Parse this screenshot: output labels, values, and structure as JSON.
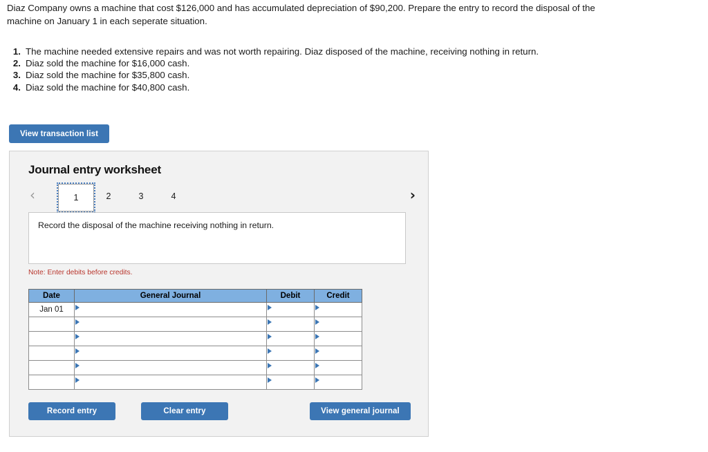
{
  "problem": {
    "statement": "Diaz Company owns a machine that cost $126,000 and has accumulated depreciation of $90,200. Prepare the entry to record the disposal of the machine on January 1 in each seperate situation.",
    "requirements": [
      {
        "num": "1.",
        "text": "The machine needed extensive repairs and was not worth repairing. Diaz disposed of the machine, receiving nothing in return."
      },
      {
        "num": "2.",
        "text": "Diaz sold the machine for $16,000 cash."
      },
      {
        "num": "3.",
        "text": "Diaz sold the machine for $35,800 cash."
      },
      {
        "num": "4.",
        "text": "Diaz sold the machine for $40,800 cash."
      }
    ]
  },
  "toolbar": {
    "view_transaction_list_label": "View transaction list"
  },
  "worksheet": {
    "title": "Journal entry worksheet",
    "tabs": [
      {
        "label": "1",
        "active": true
      },
      {
        "label": "2",
        "active": false
      },
      {
        "label": "3",
        "active": false
      },
      {
        "label": "4",
        "active": false
      }
    ],
    "prev_arrow": "‹",
    "next_arrow": "›",
    "instruction": "Record the disposal of the machine receiving nothing in return.",
    "note": "Note: Enter debits before credits.",
    "table": {
      "headers": [
        "Date",
        "General Journal",
        "Debit",
        "Credit"
      ],
      "rows": [
        {
          "date": "Jan 01",
          "general_journal": "",
          "debit": "",
          "credit": ""
        },
        {
          "date": "",
          "general_journal": "",
          "debit": "",
          "credit": ""
        },
        {
          "date": "",
          "general_journal": "",
          "debit": "",
          "credit": ""
        },
        {
          "date": "",
          "general_journal": "",
          "debit": "",
          "credit": ""
        },
        {
          "date": "",
          "general_journal": "",
          "debit": "",
          "credit": ""
        },
        {
          "date": "",
          "general_journal": "",
          "debit": "",
          "credit": ""
        }
      ]
    },
    "buttons": {
      "record_entry": "Record entry",
      "clear_entry": "Clear entry",
      "view_general_journal": "View general journal"
    }
  },
  "colors": {
    "button_blue": "#3c76b4",
    "table_header_blue": "#7fb0e0",
    "note_red": "#b8352c",
    "panel_gray": "#f2f2f2"
  }
}
